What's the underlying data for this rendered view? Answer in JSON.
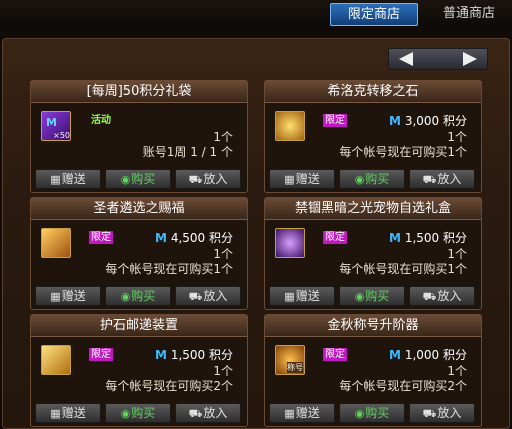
{
  "tabs": {
    "limited": "限定商店",
    "normal": "普通商店"
  },
  "buttons": {
    "gift": "赠送",
    "buy": "购买",
    "cart": "放入"
  },
  "items": [
    {
      "title": "[每周]50积分礼袋",
      "badge": "活动",
      "line1": "1个",
      "line2": "账号1周 1 / 1 个",
      "price_symbol": "",
      "price_value": "",
      "icon": "purple-bag-icon",
      "icon_label": "×50"
    },
    {
      "title": "希洛克转移之石",
      "badge": "限定",
      "price_symbol": "M",
      "price_value": "3,000 积分",
      "line1": "1个",
      "line2": "每个帐号现在可购买1个",
      "icon": "gold-stone-icon",
      "icon_label": ""
    },
    {
      "title": "圣者遴选之赐福",
      "badge": "限定",
      "price_symbol": "M",
      "price_value": "4,500 积分",
      "line1": "1个",
      "line2": "每个帐号现在可购买1个",
      "icon": "gold-chest-icon",
      "icon_label": ""
    },
    {
      "title": "禁锢黑暗之光宠物自选礼盒",
      "badge": "限定",
      "price_symbol": "M",
      "price_value": "1,500 积分",
      "line1": "1个",
      "line2": "每个帐号现在可购买1个",
      "icon": "purple-box-icon",
      "icon_label": ""
    },
    {
      "title": "护石邮递装置",
      "badge": "限定",
      "price_symbol": "M",
      "price_value": "1,500 积分",
      "line1": "1个",
      "line2": "每个帐号现在可购买2个",
      "icon": "gold-device-icon",
      "icon_label": ""
    },
    {
      "title": "金秋称号升阶器",
      "badge": "限定",
      "price_symbol": "M",
      "price_value": "1,000 积分",
      "line1": "1个",
      "line2": "每个帐号现在可购买2个",
      "icon": "title-upgrade-icon",
      "icon_label": "称号"
    }
  ],
  "colors": {
    "accent_blue": "#2d6fb8",
    "limited_badge": "#c018c0",
    "event_badge": "#9aff4a",
    "buy_text": "#5fd25f",
    "price_symbol": "#40b8ff"
  }
}
